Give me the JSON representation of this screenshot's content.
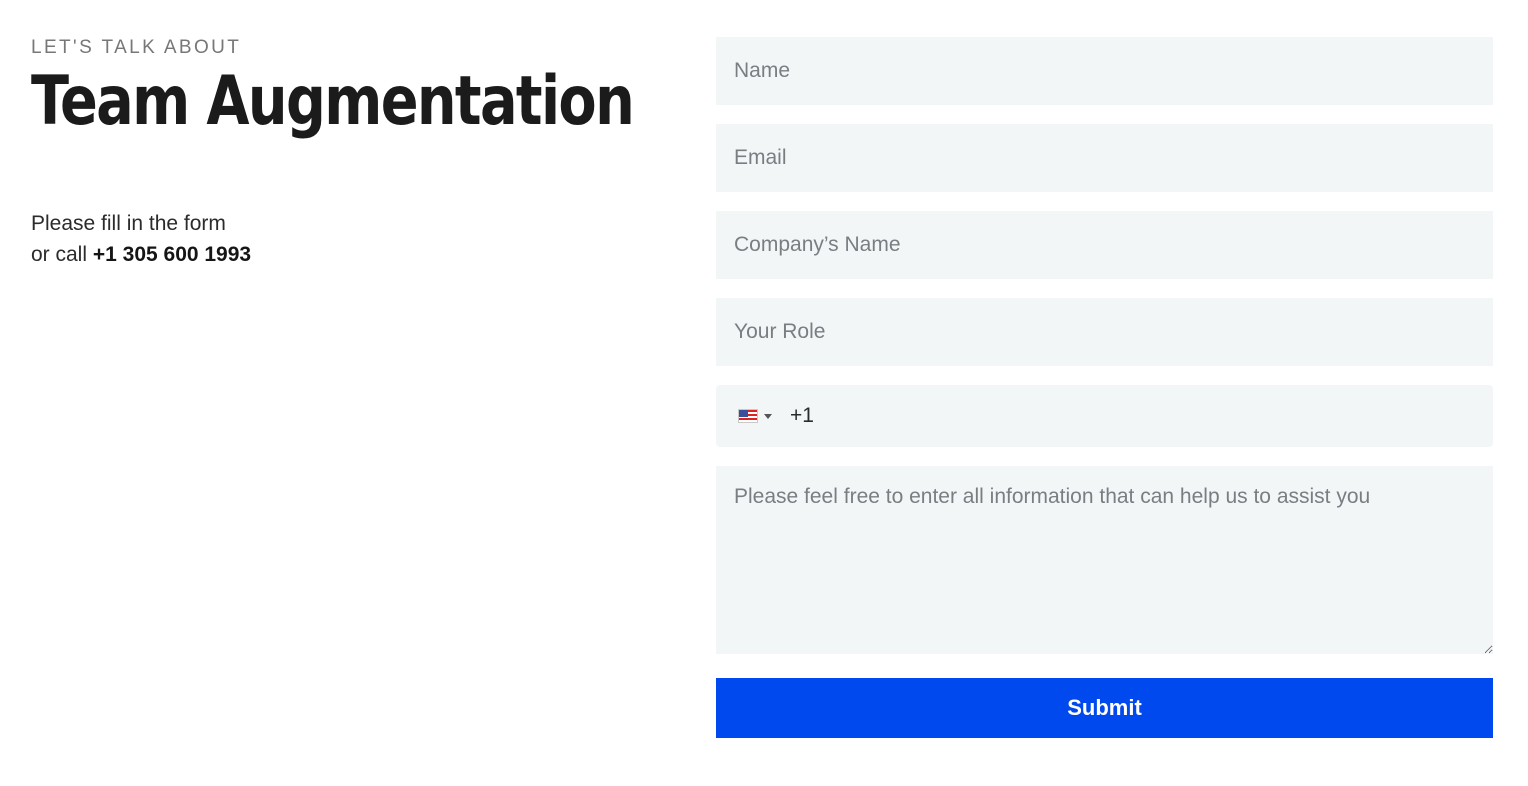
{
  "hero": {
    "eyebrow": "LET'S TALK ABOUT",
    "title": "Team Augmentation",
    "intro_line1": "Please fill in the form",
    "intro_line2_prefix": "or call ",
    "phone": "+1 305 600 1993"
  },
  "form": {
    "name_placeholder": "Name",
    "email_placeholder": "Email",
    "company_placeholder": "Company’s Name",
    "role_placeholder": "Your Role",
    "phone": {
      "country_icon": "us-flag-icon",
      "dial_code": "+1"
    },
    "message_placeholder": "Please feel free to enter all information that can help us to assist you",
    "submit_label": "Submit"
  },
  "colors": {
    "accent": "#0049ee",
    "field_bg": "#f3f6f7"
  }
}
